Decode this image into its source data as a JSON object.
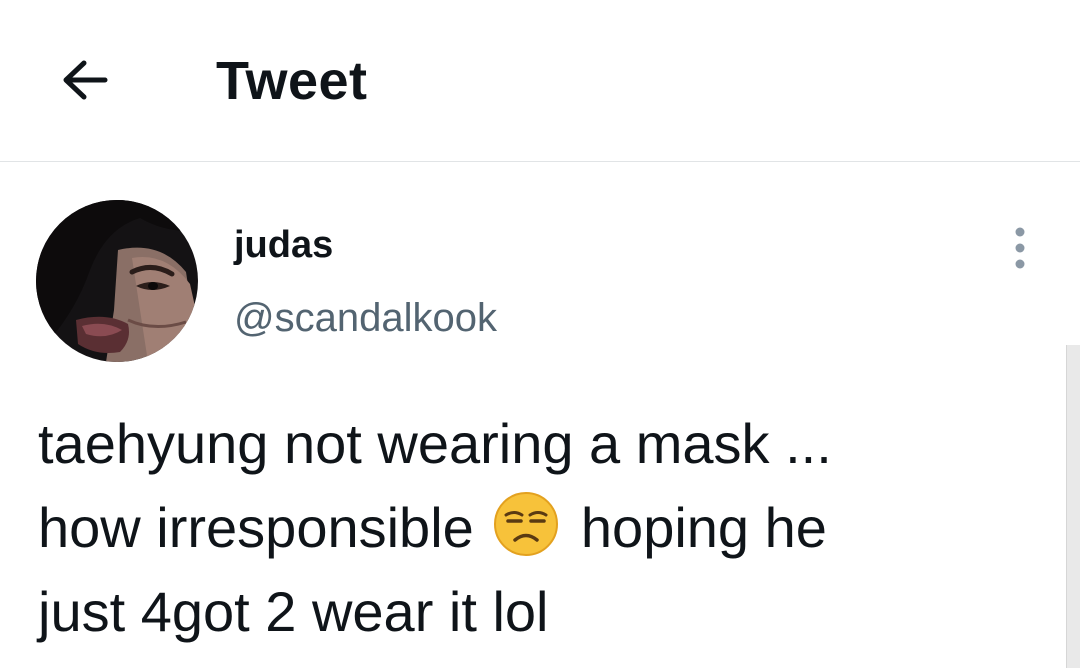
{
  "header": {
    "back_icon": "arrow-left-icon",
    "title": "Tweet"
  },
  "author": {
    "display_name": "judas",
    "handle": "@scandalkook",
    "avatar_icon": "avatar-photo"
  },
  "more_icon": "more-vertical-icon",
  "tweet": {
    "line1": "taehyung not wearing a mask ...",
    "line2_before": "how irresponsible",
    "line2_emoji": "unamused-face-emoji",
    "line2_after": "hoping he",
    "line3": "just 4got 2 wear it lol"
  },
  "colors": {
    "text": "#0f1419",
    "secondary": "#536471",
    "divider": "#e1e4e6",
    "emoji": "#f7c23a"
  }
}
